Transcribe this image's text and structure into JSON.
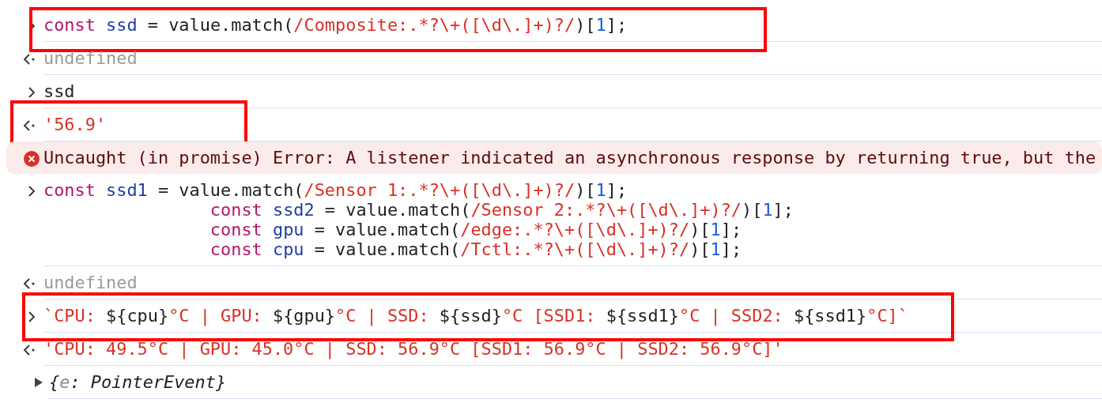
{
  "console": {
    "entries": [
      {
        "kind": "input",
        "highlighted": true,
        "lines": [
          [
            {
              "kind": "keyword",
              "text": "const "
            },
            {
              "kind": "variable",
              "text": "ssd"
            },
            {
              "kind": "plain",
              "text": " = value.match("
            },
            {
              "kind": "regex",
              "text": "/Composite:.*?\\+([\\d\\.]+)?/"
            },
            {
              "kind": "plain",
              "text": ")["
            },
            {
              "kind": "number",
              "text": "1"
            },
            {
              "kind": "plain",
              "text": "];"
            }
          ]
        ]
      },
      {
        "kind": "output",
        "highlighted": false,
        "lines": [
          [
            {
              "kind": "undefined",
              "text": "undefined"
            }
          ]
        ]
      },
      {
        "kind": "input",
        "highlighted": false,
        "lines": [
          [
            {
              "kind": "plain",
              "text": "ssd"
            }
          ]
        ]
      },
      {
        "kind": "output",
        "highlighted": true,
        "lines": [
          [
            {
              "kind": "string",
              "text": "'56.9'"
            }
          ]
        ]
      },
      {
        "kind": "error",
        "highlighted": false,
        "lines": [
          [
            {
              "kind": "error",
              "text": "Uncaught (in promise) Error: A listener indicated an asynchronous response by returning true, but the"
            }
          ]
        ]
      },
      {
        "kind": "input",
        "highlighted": false,
        "lines": [
          [
            {
              "kind": "keyword",
              "text": "const "
            },
            {
              "kind": "variable",
              "text": "ssd1"
            },
            {
              "kind": "plain",
              "text": " = value.match("
            },
            {
              "kind": "regex",
              "text": "/Sensor 1:.*?\\+([\\d\\.]+)?/"
            },
            {
              "kind": "plain",
              "text": ")["
            },
            {
              "kind": "number",
              "text": "1"
            },
            {
              "kind": "plain",
              "text": "];"
            }
          ],
          [
            {
              "kind": "keyword",
              "text": "                const "
            },
            {
              "kind": "variable",
              "text": "ssd2"
            },
            {
              "kind": "plain",
              "text": " = value.match("
            },
            {
              "kind": "regex",
              "text": "/Sensor 2:.*?\\+([\\d\\.]+)?/"
            },
            {
              "kind": "plain",
              "text": ")["
            },
            {
              "kind": "number",
              "text": "1"
            },
            {
              "kind": "plain",
              "text": "];"
            }
          ],
          [
            {
              "kind": "keyword",
              "text": "                const "
            },
            {
              "kind": "variable",
              "text": "gpu"
            },
            {
              "kind": "plain",
              "text": " = value.match("
            },
            {
              "kind": "regex",
              "text": "/edge:.*?\\+([\\d\\.]+)?/"
            },
            {
              "kind": "plain",
              "text": ")["
            },
            {
              "kind": "number",
              "text": "1"
            },
            {
              "kind": "plain",
              "text": "];"
            }
          ],
          [
            {
              "kind": "keyword",
              "text": "                const "
            },
            {
              "kind": "variable",
              "text": "cpu"
            },
            {
              "kind": "plain",
              "text": " = value.match("
            },
            {
              "kind": "regex",
              "text": "/Tctl:.*?\\+([\\d\\.]+)?/"
            },
            {
              "kind": "plain",
              "text": ")["
            },
            {
              "kind": "number",
              "text": "1"
            },
            {
              "kind": "plain",
              "text": "];"
            }
          ]
        ]
      },
      {
        "kind": "output",
        "highlighted": false,
        "lines": [
          [
            {
              "kind": "undefined",
              "text": "undefined"
            }
          ]
        ]
      },
      {
        "kind": "input",
        "highlighted": true,
        "lines": [
          [
            {
              "kind": "string",
              "text": "`CPU: "
            },
            {
              "kind": "plain",
              "text": "${cpu}"
            },
            {
              "kind": "string",
              "text": "°C | GPU: "
            },
            {
              "kind": "plain",
              "text": "${gpu}"
            },
            {
              "kind": "string",
              "text": "°C | SSD: "
            },
            {
              "kind": "plain",
              "text": "${ssd}"
            },
            {
              "kind": "string",
              "text": "°C [SSD1: "
            },
            {
              "kind": "plain",
              "text": "${ssd1}"
            },
            {
              "kind": "string",
              "text": "°C | SSD2: "
            },
            {
              "kind": "plain",
              "text": "${ssd1}"
            },
            {
              "kind": "string",
              "text": "°C]`"
            }
          ]
        ]
      },
      {
        "kind": "output",
        "highlighted": false,
        "lines": [
          [
            {
              "kind": "string",
              "text": "'CPU: 49.5°C | GPU: 45.0°C | SSD: 56.9°C [SSD1: 56.9°C | SSD2: 56.9°C]'"
            }
          ]
        ]
      },
      {
        "kind": "object",
        "highlighted": false,
        "expanded": false,
        "lines": [
          [
            {
              "kind": "plain",
              "text": "{"
            },
            {
              "kind": "key",
              "text": "e"
            },
            {
              "kind": "plain",
              "text": ": PointerEvent}"
            }
          ]
        ]
      }
    ]
  }
}
